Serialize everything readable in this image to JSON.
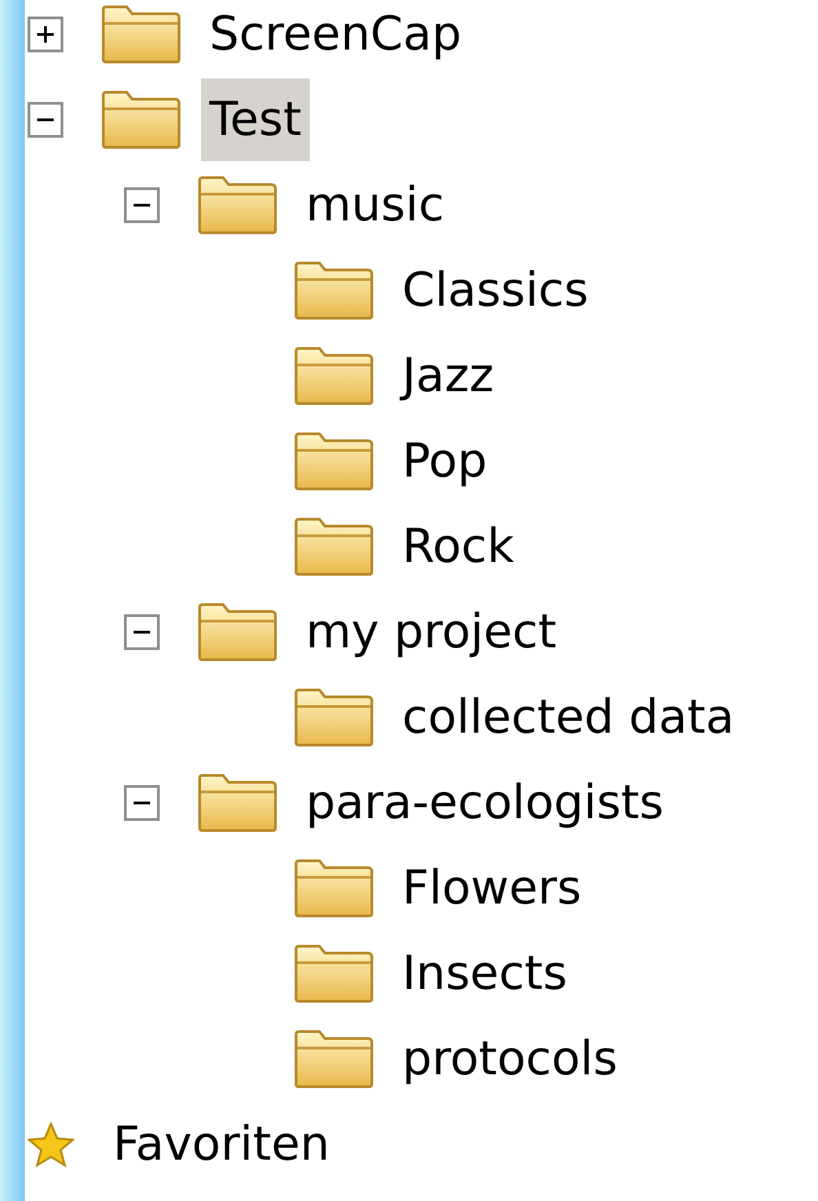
{
  "tree": [
    {
      "kind": "folder",
      "label": "ScreenCap",
      "expanded": false,
      "selected": false
    },
    {
      "kind": "folder",
      "label": "Test",
      "expanded": true,
      "selected": true,
      "children": [
        {
          "kind": "folder",
          "label": "music",
          "expanded": true,
          "selected": false,
          "children": [
            {
              "kind": "folder",
              "label": "Classics",
              "selected": false
            },
            {
              "kind": "folder",
              "label": "Jazz",
              "selected": false
            },
            {
              "kind": "folder",
              "label": "Pop",
              "selected": false
            },
            {
              "kind": "folder",
              "label": "Rock",
              "selected": false
            }
          ]
        },
        {
          "kind": "folder",
          "label": "my project",
          "expanded": true,
          "selected": false,
          "children": [
            {
              "kind": "folder",
              "label": "collected data",
              "selected": false
            }
          ]
        },
        {
          "kind": "folder",
          "label": "para-ecologists",
          "expanded": true,
          "selected": false,
          "children": [
            {
              "kind": "folder",
              "label": "Flowers",
              "selected": false
            },
            {
              "kind": "folder",
              "label": "Insects",
              "selected": false
            },
            {
              "kind": "folder",
              "label": "protocols",
              "selected": false
            }
          ]
        }
      ]
    },
    {
      "kind": "favorites",
      "label": "Favoriten",
      "selected": false
    }
  ]
}
